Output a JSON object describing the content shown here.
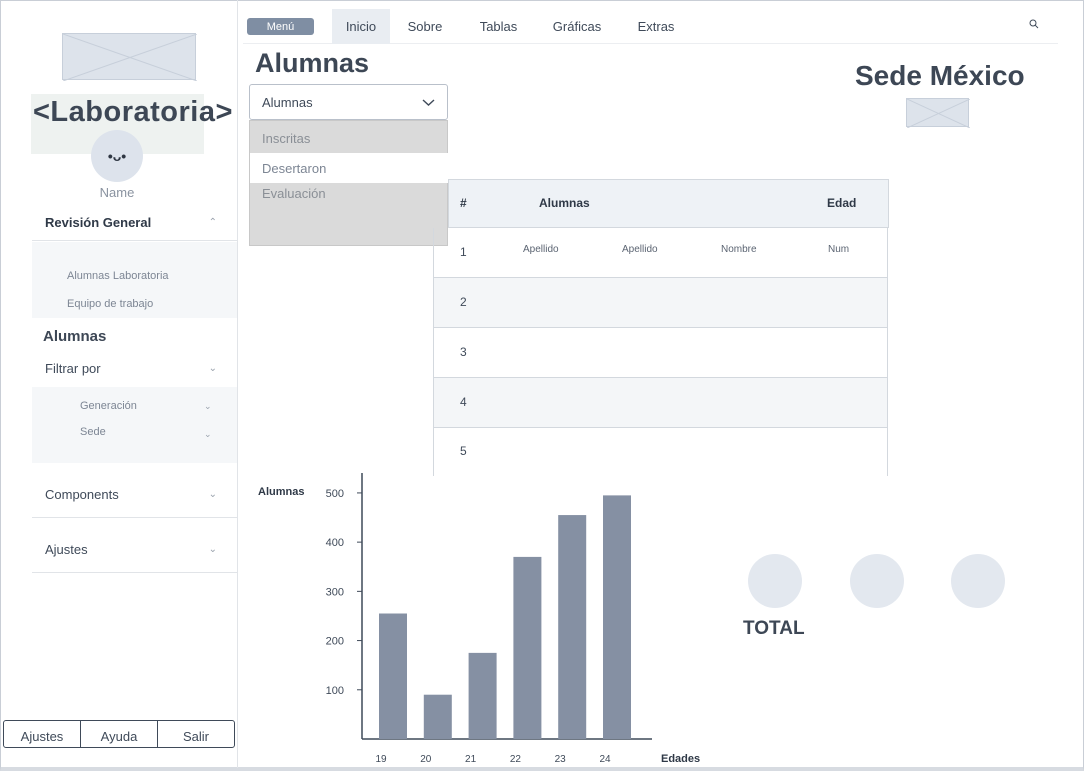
{
  "sidebar": {
    "brand": "<Laboratoria>",
    "avatar_face": "•ᴗ•",
    "user_name": "Name",
    "overview": "Revisión General",
    "overview_items": [
      "Alumnas Laboratoria",
      "Equipo de trabajo"
    ],
    "section_title": "Alumnas",
    "filter_label": "Filtrar por",
    "filter_items": [
      "Generación",
      "Sede"
    ],
    "components": "Components",
    "settings": "Ajustes",
    "footer_buttons": [
      "Ajustes",
      "Ayuda",
      "Salir"
    ]
  },
  "topbar": {
    "menu_button": "Menú",
    "tabs": [
      "Inicio",
      "Sobre",
      "Tablas",
      "Gráficas",
      "Extras"
    ],
    "active_tab": "Inicio"
  },
  "header": {
    "page_title": "Alumnas",
    "select_value": "Alumnas",
    "dropdown_options": [
      "Inscritas",
      "Desertaron",
      "Evaluación"
    ],
    "highlighted_option": "Desertaron",
    "location_title": "Sede México"
  },
  "table": {
    "headers": [
      "#",
      "Alumnas",
      "Edad"
    ],
    "rows": [
      {
        "num": "1",
        "cells": [
          "Apellido",
          "Apellido",
          "Nombre",
          "Num"
        ]
      },
      {
        "num": "2",
        "cells": []
      },
      {
        "num": "3",
        "cells": []
      },
      {
        "num": "4",
        "cells": []
      },
      {
        "num": "5",
        "cells": []
      }
    ]
  },
  "chart_data": {
    "type": "bar",
    "categories": [
      "19",
      "20",
      "21",
      "22",
      "23",
      "24"
    ],
    "values": [
      255,
      90,
      175,
      370,
      455,
      495
    ],
    "ylabel": "Alumnas",
    "xlabel": "Edades",
    "yticks": [
      100,
      200,
      300,
      400,
      500
    ],
    "ylim": [
      0,
      510
    ],
    "grid": false,
    "bar_color": "#8590a3"
  },
  "totals": {
    "label": "TOTAL",
    "circle_color": "#e3e8ef"
  },
  "colors": {
    "accent": "#7f8ea3",
    "text": "#3f4a59",
    "dropdown_bg": "#dadada"
  }
}
